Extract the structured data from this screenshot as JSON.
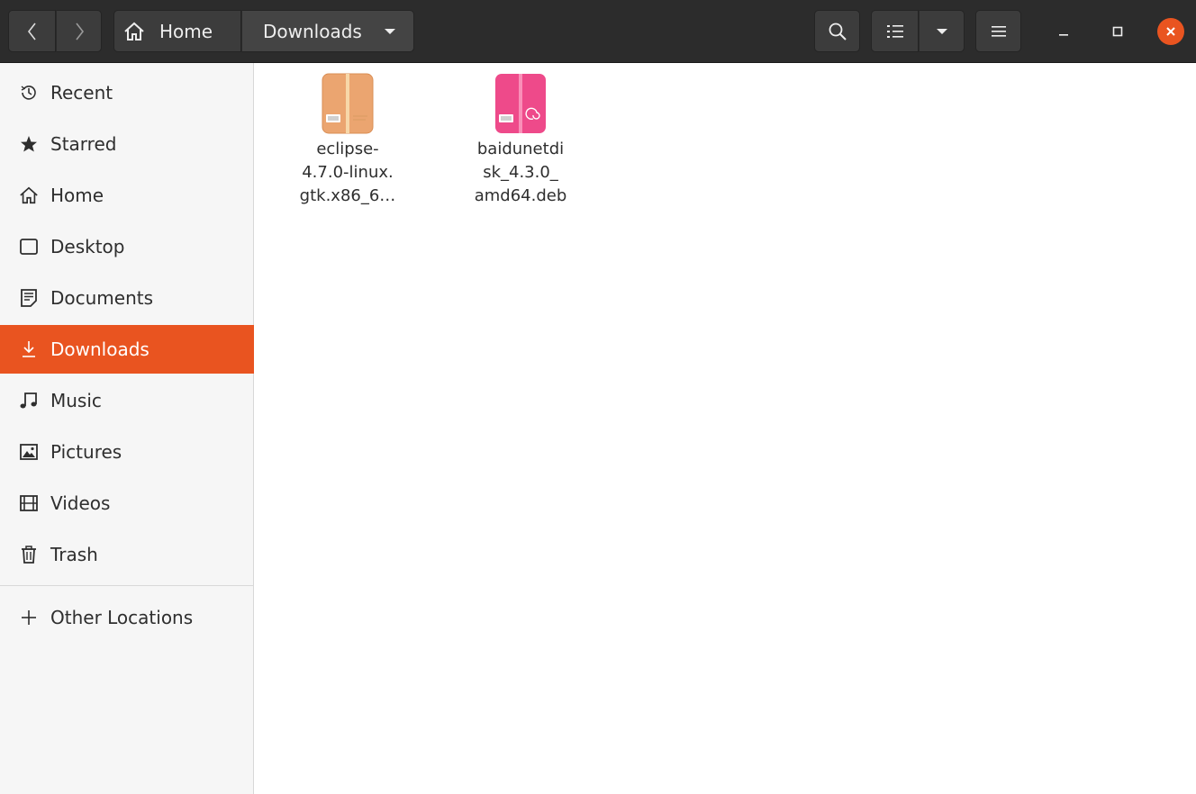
{
  "header": {
    "back_icon": "chevron-left-icon",
    "forward_icon": "chevron-right-icon",
    "path": [
      {
        "label": "Home",
        "icon": "home-icon"
      },
      {
        "label": "Downloads",
        "icon": "chevron-down-icon"
      }
    ],
    "search_icon": "search-icon",
    "view_icon": "list-view-icon",
    "view_dropdown_icon": "chevron-down-icon",
    "menu_icon": "hamburger-menu-icon",
    "window_controls": [
      "minimize-icon",
      "maximize-icon",
      "close-icon"
    ],
    "accent_color": "#e95420"
  },
  "sidebar": {
    "items": [
      {
        "label": "Recent",
        "icon": "clock-icon"
      },
      {
        "label": "Starred",
        "icon": "star-icon"
      },
      {
        "label": "Home",
        "icon": "home-icon"
      },
      {
        "label": "Desktop",
        "icon": "desktop-icon"
      },
      {
        "label": "Documents",
        "icon": "document-icon"
      },
      {
        "label": "Downloads",
        "icon": "download-icon",
        "active": true
      },
      {
        "label": "Music",
        "icon": "music-note-icon"
      },
      {
        "label": "Pictures",
        "icon": "picture-icon"
      },
      {
        "label": "Videos",
        "icon": "film-icon"
      },
      {
        "label": "Trash",
        "icon": "trash-icon"
      }
    ],
    "other_locations": {
      "label": "Other Locations",
      "icon": "plus-icon"
    }
  },
  "files": [
    {
      "name": "eclipse-\n4.7.0-linux.\ngtk.x86_6…",
      "icon": "archive-package-icon",
      "color": "#e9a56f"
    },
    {
      "name": "baidunetdi\nsk_4.3.0_\namd64.deb",
      "icon": "debian-package-icon",
      "color": "#ee4a8a"
    }
  ]
}
